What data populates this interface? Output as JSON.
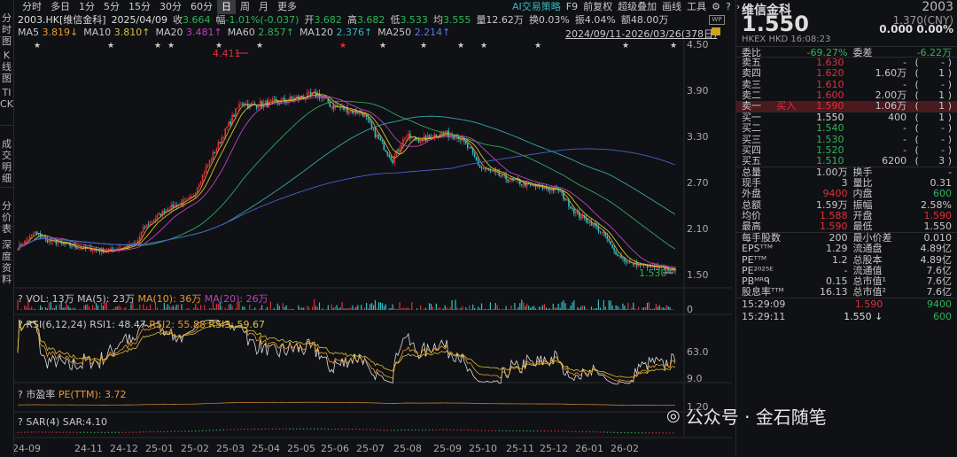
{
  "sidebar": [
    "分时图",
    "K线图",
    "TICK",
    "成交明细",
    "分价表",
    "深度资料"
  ],
  "tabs": [
    "分时",
    "多日",
    "1分",
    "5分",
    "15分",
    "30分",
    "60分",
    "日",
    "周",
    "月",
    "更多"
  ],
  "active_tab": "日",
  "tools": [
    "AI交易策略",
    "F9",
    "前复权",
    "超级叠加",
    "画线",
    "工具"
  ],
  "info": {
    "symbol": "2003.HK[维信金科]",
    "date": "2025/04/09",
    "close_l": "收",
    "close": "3.664",
    "chg_l": "幅",
    "chg": "-1.01%(-0.037)",
    "open_l": "开",
    "open": "3.682",
    "high_l": "高",
    "high": "3.682",
    "low_l": "低",
    "low": "3.533",
    "avg_l": "均",
    "avg": "3.555",
    "vol": "量12.62万",
    "turn": "换0.03%",
    "amp": "振4.04%",
    "amt": "额48.00万"
  },
  "ma": {
    "ma5": "MA5",
    "v5": "3.819↓",
    "ma10": "MA10",
    "v10": "3.810↑",
    "ma20": "MA20",
    "v20": "3.481↑",
    "ma60": "MA60",
    "v60": "2.857↑",
    "ma120": "MA120",
    "v120": "2.376↑",
    "ma250": "MA250",
    "v250": "2.214↑"
  },
  "range": "2024/09/11-2026/03/26(378日)",
  "price_axis": [
    "4.50",
    "3.90",
    "3.30",
    "2.70",
    "2.10",
    "1.50"
  ],
  "annotations": {
    "high": "4.411",
    "low": "1.530"
  },
  "price_keypoints": [
    [
      0,
      1.85
    ],
    [
      10,
      2.05
    ],
    [
      16,
      1.95
    ],
    [
      35,
      1.85
    ],
    [
      50,
      1.8
    ],
    [
      68,
      1.9
    ],
    [
      72,
      2.1
    ],
    [
      85,
      2.35
    ],
    [
      100,
      2.5
    ],
    [
      105,
      2.75
    ],
    [
      115,
      3.2
    ],
    [
      122,
      3.5
    ],
    [
      128,
      3.75
    ],
    [
      133,
      3.7
    ],
    [
      150,
      3.75
    ],
    [
      160,
      3.8
    ],
    [
      172,
      3.85
    ],
    [
      180,
      3.7
    ],
    [
      198,
      3.6
    ],
    [
      203,
      3.4
    ],
    [
      215,
      3.0
    ],
    [
      222,
      3.3
    ],
    [
      232,
      3.25
    ],
    [
      242,
      3.35
    ],
    [
      253,
      3.3
    ],
    [
      260,
      3.1
    ],
    [
      265,
      2.9
    ],
    [
      280,
      2.75
    ],
    [
      295,
      2.65
    ],
    [
      310,
      2.6
    ],
    [
      320,
      2.3
    ],
    [
      330,
      2.15
    ],
    [
      337,
      2.0
    ],
    [
      342,
      1.8
    ],
    [
      350,
      1.65
    ],
    [
      377,
      1.55
    ]
  ],
  "vol": {
    "q": "?",
    "label": "VOL: 13万",
    "ma5": "MA(5): 23万",
    "ma10": "MA(10): 36万",
    "ma20": "MA(20): 26万",
    "axis": "0"
  },
  "rsi": {
    "q": "?",
    "label": "RSI(6,12,24)",
    "r1": "RSI1: 48.47",
    "r2": "RSI2: 55.88",
    "r3": "RSI3: 59.67",
    "axis_top": "63.0",
    "axis_bot": "9.0"
  },
  "pe": {
    "q": "?",
    "label": "市盈率",
    "value": "PE(TTM): 3.72",
    "axis": "1.20"
  },
  "sar": {
    "q": "?",
    "label": "SAR(4)",
    "value": "SAR:4.10"
  },
  "time_axis": [
    "24-09",
    "24-11",
    "24-12",
    "25-01",
    "25-02",
    "25-03",
    "25-04",
    "25-05",
    "25-06",
    "25-07",
    "25-08",
    "25-09",
    "25-10",
    "25-11",
    "25-12",
    "26-01",
    "26-02"
  ],
  "quote": {
    "name": "维信金科",
    "code": "2003",
    "price": "1.550",
    "cny": "1.370(CNY)",
    "chg": "0.000",
    "pct": "0.00%",
    "exch": "HKEX",
    "cur": "HKD",
    "time": "16:08:23",
    "wb_l": "委比",
    "wb": "-69.27%",
    "wc_l": "委差",
    "wc": "-6.22万",
    "asks": [
      [
        "卖五",
        "1.630",
        "-",
        "-"
      ],
      [
        "卖四",
        "1.620",
        "1.60万",
        "1"
      ],
      [
        "卖三",
        "1.610",
        "-",
        "-"
      ],
      [
        "卖二",
        "1.600",
        "2.00万",
        "1"
      ],
      [
        "卖一",
        "1.590",
        "1.06万",
        "1"
      ]
    ],
    "buy_in": "买入",
    "bids": [
      [
        "买一",
        "1.550",
        "400",
        "1"
      ],
      [
        "买二",
        "1.540",
        "-",
        "-"
      ],
      [
        "买三",
        "1.530",
        "-",
        "-"
      ],
      [
        "买四",
        "1.520",
        "-",
        "-"
      ],
      [
        "买五",
        "1.510",
        "6200",
        "3"
      ]
    ],
    "stats": [
      [
        "总量",
        "1.00万",
        "换手",
        "-"
      ],
      [
        "现手",
        "3",
        "量比",
        "0.31"
      ],
      [
        "外盘",
        "9400",
        "内盘",
        "600"
      ],
      [
        "总额",
        "1.59万",
        "振幅",
        "2.58%"
      ],
      [
        "均价",
        "1.588",
        "开盘",
        "1.590"
      ],
      [
        "最高",
        "1.590",
        "最低",
        "1.550"
      ]
    ],
    "fund": [
      [
        "每手股数",
        "200",
        "最小价差",
        "0.010"
      ],
      [
        "EPSᵀᵀᴹ",
        "1.29",
        "流通盘",
        "4.89亿"
      ],
      [
        "PEᵀᵀᴹ",
        "1.2",
        "总股本",
        "4.89亿"
      ],
      [
        "PE²⁰²⁵ᴱ",
        "-",
        "流通值",
        "7.6亿"
      ],
      [
        "PBᴹᴿᑫ",
        "0.15",
        "总市值¹",
        "7.6亿"
      ],
      [
        "股息率ᵀᵀᴹ",
        "16.13",
        "总市值²",
        "7.6亿"
      ]
    ],
    "ticks": [
      [
        "15:29:09",
        "1.590",
        "9400"
      ],
      [
        "15:29:11",
        "1.550 ↓",
        "600"
      ]
    ]
  },
  "watermark": "公众号 · 金石随笔"
}
